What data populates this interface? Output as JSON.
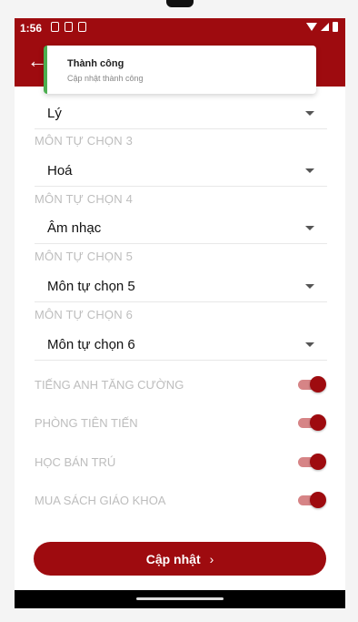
{
  "status_bar": {
    "time": "1:56"
  },
  "toast": {
    "title": "Thành công",
    "message": "Cập nhật thành công"
  },
  "fields": [
    {
      "label": "",
      "value": "Lý"
    },
    {
      "label": "MÔN TỰ CHỌN 3",
      "value": "Hoá"
    },
    {
      "label": "MÔN TỰ CHỌN 4",
      "value": "Âm nhạc"
    },
    {
      "label": "MÔN TỰ CHỌN 5",
      "value": "Môn tự chọn 5"
    },
    {
      "label": "MÔN TỰ CHỌN 6",
      "value": "Môn tự chọn 6"
    }
  ],
  "toggles": [
    {
      "label": "TIẾNG ANH TĂNG CƯỜNG",
      "on": true
    },
    {
      "label": "PHÒNG TIÊN TIẾN",
      "on": true
    },
    {
      "label": "HỌC BÁN TRÚ",
      "on": true
    },
    {
      "label": "MUA SÁCH GIÁO KHOA",
      "on": true
    }
  ],
  "update_button": {
    "label": "Cập nhật",
    "chevron": "›"
  },
  "colors": {
    "brand": "#9e0b0f",
    "toast_accent": "#4caf50",
    "label": "#bdbdbd"
  }
}
